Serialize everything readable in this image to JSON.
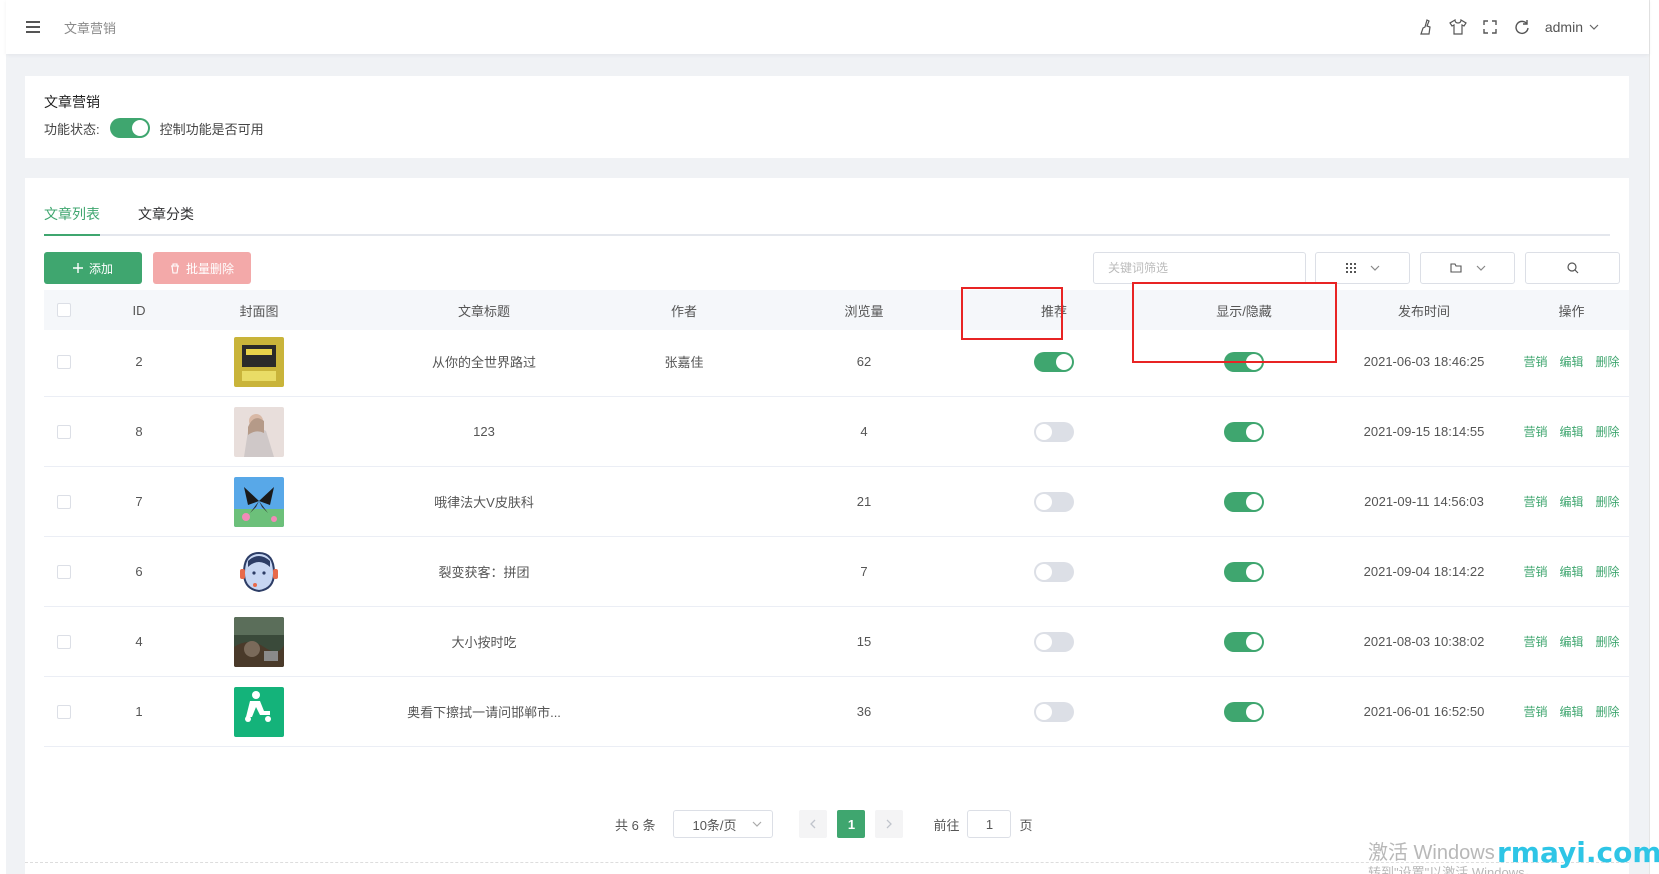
{
  "header": {
    "breadcrumb": "文章营销",
    "user": "admin",
    "icons": [
      "broom-icon",
      "tshirt-icon",
      "fullscreen-icon",
      "refresh-icon"
    ]
  },
  "function_card": {
    "title": "文章营销",
    "status_label": "功能状态:",
    "status_on": true,
    "status_desc": "控制功能是否可用"
  },
  "tabs": [
    "文章列表",
    "文章分类"
  ],
  "toolbar": {
    "add_label": "添加",
    "batch_delete_label": "批量删除",
    "keyword_placeholder": "关键词筛选"
  },
  "table": {
    "columns": [
      "ID",
      "封面图",
      "文章标题",
      "作者",
      "浏览量",
      "推荐",
      "显示/隐藏",
      "发布时间",
      "操作"
    ],
    "rows": [
      {
        "id": "2",
        "cover": "book",
        "title": "从你的全世界路过",
        "author": "张嘉佳",
        "views": "62",
        "recommend": true,
        "visible": true,
        "time": "2021-06-03 18:46:25"
      },
      {
        "id": "8",
        "cover": "girl",
        "title": "123",
        "author": "",
        "views": "4",
        "recommend": false,
        "visible": true,
        "time": "2021-09-15 18:14:55"
      },
      {
        "id": "7",
        "cover": "butterfly",
        "title": "哦律法大V皮肤科",
        "author": "",
        "views": "21",
        "recommend": false,
        "visible": true,
        "time": "2021-09-11 14:56:03"
      },
      {
        "id": "6",
        "cover": "avatar",
        "title": "裂变获客：拼团",
        "author": "",
        "views": "7",
        "recommend": false,
        "visible": true,
        "time": "2021-09-04 18:14:22"
      },
      {
        "id": "4",
        "cover": "photo",
        "title": "大小按时吃",
        "author": "",
        "views": "15",
        "recommend": false,
        "visible": true,
        "time": "2021-08-03 10:38:02"
      },
      {
        "id": "1",
        "cover": "delivery",
        "title": "奥看下擦拭一请问邯郸市...",
        "author": "",
        "views": "36",
        "recommend": false,
        "visible": true,
        "time": "2021-06-01 16:52:50"
      }
    ],
    "actions": [
      "营销",
      "编辑",
      "删除"
    ]
  },
  "pagination": {
    "total_text": "共 6 条",
    "page_size": "10条/页",
    "current_page": "1",
    "goto_label": "前往",
    "goto_value": "1",
    "page_suffix": "页"
  },
  "overlay": {
    "watermark_line1": "激活 Windows",
    "watermark_line2": "转到\"设置\"以激活 Windows。",
    "brand": "rmayi.com"
  },
  "colors": {
    "primary": "#3fa66f",
    "danger_light": "#f3a9a9",
    "highlight": "#e82424"
  }
}
